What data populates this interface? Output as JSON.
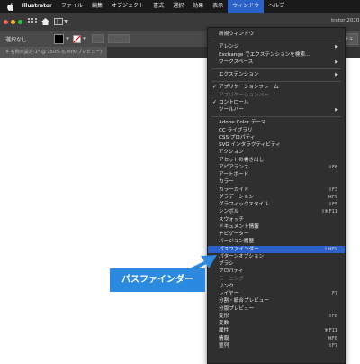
{
  "menubar": {
    "app_name": "Illustrator",
    "items": [
      "ファイル",
      "編集",
      "オブジェクト",
      "書式",
      "選択",
      "効果",
      "表示",
      "ウィンドウ",
      "ヘルプ"
    ],
    "active_index": 7
  },
  "toolbar": {
    "window_title_fragment": "trator 2020"
  },
  "control_bar": {
    "selection_label": "選択なし",
    "tab_label": "ドキュ"
  },
  "document_tab": {
    "label": "名称未設定-1* @ 150% (CMYK/プレビュー)"
  },
  "window_menu": {
    "items": [
      {
        "label": "新規ウィンドウ"
      },
      {
        "separator": true
      },
      {
        "label": "アレンジ",
        "submenu": true
      },
      {
        "label": "Exchange でエクステンションを検索..."
      },
      {
        "label": "ワークスペース",
        "submenu": true
      },
      {
        "separator": true
      },
      {
        "label": "エクステンション",
        "submenu": true
      },
      {
        "separator": true
      },
      {
        "label": "アプリケーションフレーム",
        "checked": true
      },
      {
        "label": "アプリケーションバー",
        "disabled": true
      },
      {
        "label": "コントロール",
        "checked": true
      },
      {
        "label": "ツールバー",
        "submenu": true
      },
      {
        "separator": true
      },
      {
        "label": "Adobe Color テーマ"
      },
      {
        "label": "CC ライブラリ"
      },
      {
        "label": "CSS プロパティ"
      },
      {
        "label": "SVG インタラクティビティ"
      },
      {
        "label": "アクション"
      },
      {
        "label": "アセットの書き出し"
      },
      {
        "label": "アピアランス",
        "shortcut": "⇧F6"
      },
      {
        "label": "アートボード"
      },
      {
        "label": "カラー"
      },
      {
        "label": "カラーガイド",
        "shortcut": "⇧F3"
      },
      {
        "label": "グラデーション",
        "shortcut": "⌘F9"
      },
      {
        "label": "グラフィックスタイル",
        "shortcut": "⇧F5"
      },
      {
        "label": "シンボル",
        "shortcut": "⇧⌘F11"
      },
      {
        "label": "スウォッチ"
      },
      {
        "label": "ドキュメント情報"
      },
      {
        "label": "ナビゲーター"
      },
      {
        "label": "バージョン履歴"
      },
      {
        "label": "パスファインダー",
        "shortcut": "⇧⌘F9",
        "highlighted": true
      },
      {
        "label": "パターンオプション"
      },
      {
        "label": "ブラシ"
      },
      {
        "label": "プロパティ"
      },
      {
        "label": "ラーニング",
        "disabled": true
      },
      {
        "label": "リンク"
      },
      {
        "label": "レイヤー",
        "shortcut": "F7"
      },
      {
        "label": "分割・統合プレビュー"
      },
      {
        "label": "分版プレビュー"
      },
      {
        "label": "変形",
        "shortcut": "⇧F8"
      },
      {
        "label": "変数"
      },
      {
        "label": "属性",
        "shortcut": "⌘F11"
      },
      {
        "label": "情報",
        "shortcut": "⌘F8"
      },
      {
        "label": "整列",
        "shortcut": "⇧F7"
      }
    ]
  },
  "callout": {
    "text": "パスファインダー"
  },
  "colors": {
    "highlight": "#2a62c9",
    "callout": "#2b8ae0",
    "menu_bg": "#2f2f2f"
  }
}
